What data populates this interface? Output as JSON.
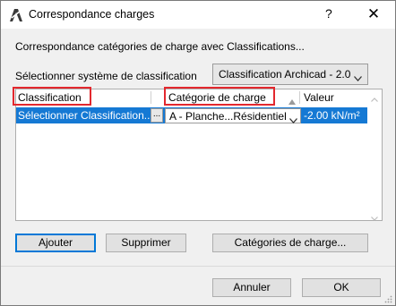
{
  "window": {
    "title": "Correspondance charges",
    "help_label": "?",
    "close_label": "✕"
  },
  "intro_text": "Correspondance catégories de charge avec Classifications...",
  "system": {
    "label": "Sélectionner système de classification",
    "selected": "Classification Archicad - 2.0"
  },
  "table": {
    "columns": [
      "Classification",
      "Catégorie de charge",
      "Valeur"
    ],
    "rows": [
      {
        "classification": "Sélectionner Classification...",
        "browse_label": "...",
        "category": "A - Planche...Résidentiel",
        "value": "-2.00 kN/m²"
      }
    ]
  },
  "buttons": {
    "add": "Ajouter",
    "delete": "Supprimer",
    "categories": "Catégories de charge...",
    "cancel": "Annuler",
    "ok": "OK"
  },
  "colors": {
    "selection": "#1579d4",
    "highlight_box": "#e3282e",
    "default_button_border": "#0078d7"
  }
}
